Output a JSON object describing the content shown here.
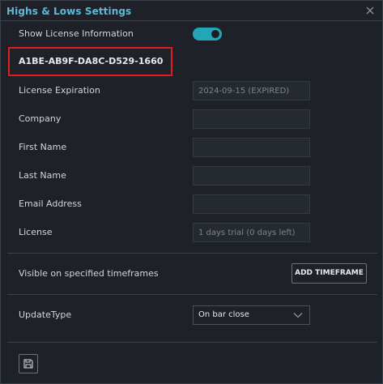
{
  "window": {
    "title": "Highs & Lows Settings"
  },
  "show_license": {
    "label": "Show License Information",
    "enabled": true
  },
  "license_key": "A1BE-AB9F-DA8C-D529-1660",
  "fields": [
    {
      "label": "License Expiration",
      "value": "2024-09-15 (EXPIRED)"
    },
    {
      "label": "Company",
      "value": ""
    },
    {
      "label": "First Name",
      "value": ""
    },
    {
      "label": "Last Name",
      "value": ""
    },
    {
      "label": "Email Address",
      "value": ""
    },
    {
      "label": "License",
      "value": "1 days trial (0 days left)"
    }
  ],
  "timeframes": {
    "label": "Visible on specified timeframes",
    "button_label": "ADD TIMEFRAME"
  },
  "update_type": {
    "label": "UpdateType",
    "selected": "On bar close"
  },
  "colors": {
    "title": "#5fb8d8",
    "toggle_on": "#22a6b8",
    "highlight": "#e01e1e"
  },
  "icons": {
    "close": "close-icon",
    "save": "save-icon",
    "dropdown": "chevron-down-icon"
  }
}
